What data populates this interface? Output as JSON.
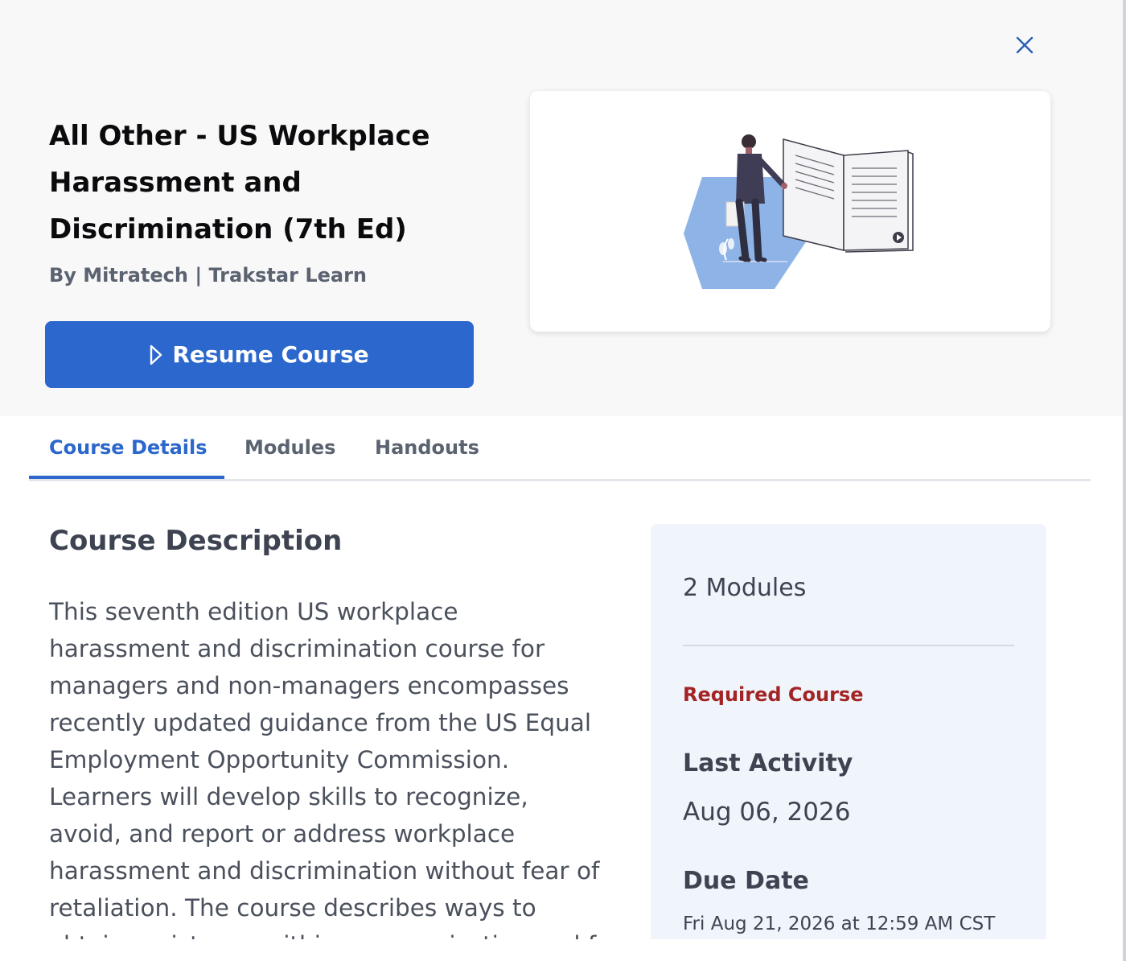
{
  "modal": {
    "close_label": "Close",
    "title": "All Other - US Workplace Harassment and Discrimination (7th Ed)",
    "byline": "By Mitratech | Trakstar Learn",
    "resume_button": "Resume Course"
  },
  "tabs": [
    {
      "label": "Course Details",
      "active": true
    },
    {
      "label": "Modules",
      "active": false
    },
    {
      "label": "Handouts",
      "active": false
    }
  ],
  "description": {
    "heading": "Course Description",
    "text": "This seventh edition US workplace harassment and discrimination course for managers and non-managers encompasses recently updated guidance from the US Equal Employment Opportunity Commission. Learners will develop skills to recognize, avoid, and report or address workplace harassment and discrimination without fear of retaliation. The course describes ways to obtain assistance within an organization and f"
  },
  "sidebar": {
    "modules_count": "2 Modules",
    "required": "Required Course",
    "last_activity_label": "Last Activity",
    "last_activity_value": "Aug 06, 2026",
    "due_date_label": "Due Date",
    "due_date_value": "Fri Aug 21, 2026 at 12:59 AM CST"
  },
  "colors": {
    "accent": "#2b67cc",
    "required": "#a32424",
    "panel_bg": "#f0f4fb",
    "hero_bg": "#f8f8f9"
  },
  "icons": {
    "close": "close-icon",
    "play": "play-outline-icon",
    "illustration": "course-illustration"
  }
}
